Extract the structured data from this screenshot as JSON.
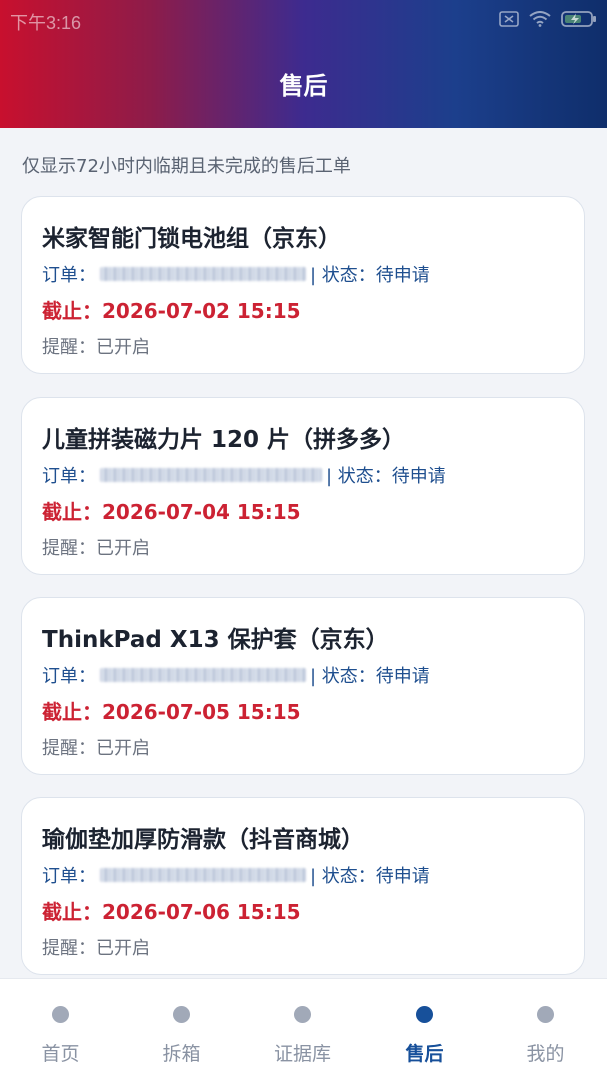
{
  "status_bar": {
    "time": "下午3:16"
  },
  "header": {
    "title": "售后"
  },
  "notice": "仅显示72小时内临期且未完成的售后工单",
  "cards": [
    {
      "title": "米家智能门锁电池组（京东）",
      "order_label": "订单：",
      "status_text": "| 状态：待申请",
      "deadline": "截止：2026-07-02 15:15",
      "reminder": "提醒：已开启"
    },
    {
      "title": "儿童拼装磁力片 120 片（拼多多）",
      "order_label": "订单：",
      "status_text": "| 状态：待申请",
      "deadline": "截止：2026-07-04 15:15",
      "reminder": "提醒：已开启"
    },
    {
      "title": "ThinkPad X13 保护套（京东）",
      "order_label": "订单：",
      "status_text": "| 状态：待申请",
      "deadline": "截止：2026-07-05 15:15",
      "reminder": "提醒：已开启"
    },
    {
      "title": "瑜伽垫加厚防滑款（抖音商城）",
      "order_label": "订单：",
      "status_text": "| 状态：待申请",
      "deadline": "截止：2026-07-06 15:15",
      "reminder": "提醒：已开启"
    }
  ],
  "tabs": [
    {
      "label": "首页",
      "active": false
    },
    {
      "label": "拆箱",
      "active": false
    },
    {
      "label": "证据库",
      "active": false
    },
    {
      "label": "售后",
      "active": true
    },
    {
      "label": "我的",
      "active": false
    }
  ],
  "colors": {
    "accent": "#17509a",
    "deadline": "#cc2233",
    "header_left": "#c8102e",
    "header_right": "#0f2e6b"
  }
}
